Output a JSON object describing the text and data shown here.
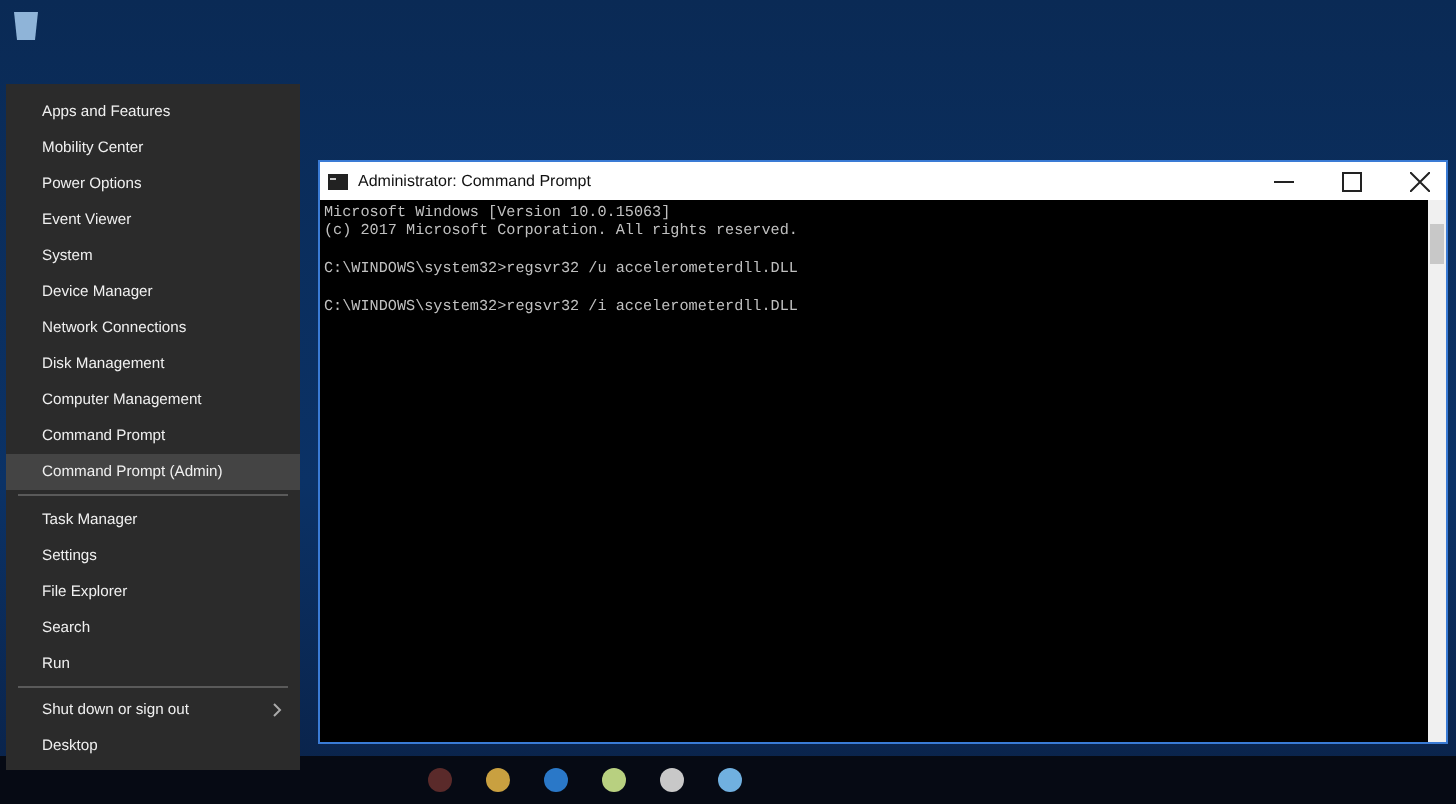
{
  "menu": {
    "groups": [
      [
        {
          "label": "Apps and Features",
          "selected": false,
          "has_submenu": false
        },
        {
          "label": "Mobility Center",
          "selected": false,
          "has_submenu": false
        },
        {
          "label": "Power Options",
          "selected": false,
          "has_submenu": false
        },
        {
          "label": "Event Viewer",
          "selected": false,
          "has_submenu": false
        },
        {
          "label": "System",
          "selected": false,
          "has_submenu": false
        },
        {
          "label": "Device Manager",
          "selected": false,
          "has_submenu": false
        },
        {
          "label": "Network Connections",
          "selected": false,
          "has_submenu": false
        },
        {
          "label": "Disk Management",
          "selected": false,
          "has_submenu": false
        },
        {
          "label": "Computer Management",
          "selected": false,
          "has_submenu": false
        },
        {
          "label": "Command Prompt",
          "selected": false,
          "has_submenu": false
        },
        {
          "label": "Command Prompt (Admin)",
          "selected": true,
          "has_submenu": false
        }
      ],
      [
        {
          "label": "Task Manager",
          "selected": false,
          "has_submenu": false
        },
        {
          "label": "Settings",
          "selected": false,
          "has_submenu": false
        },
        {
          "label": "File Explorer",
          "selected": false,
          "has_submenu": false
        },
        {
          "label": "Search",
          "selected": false,
          "has_submenu": false
        },
        {
          "label": "Run",
          "selected": false,
          "has_submenu": false
        }
      ],
      [
        {
          "label": "Shut down or sign out",
          "selected": false,
          "has_submenu": true
        },
        {
          "label": "Desktop",
          "selected": false,
          "has_submenu": false
        }
      ]
    ]
  },
  "window": {
    "title": "Administrator: Command Prompt",
    "console_paragraphs": [
      [
        "Microsoft Windows [Version 10.0.15063]",
        "(c) 2017 Microsoft Corporation. All rights reserved."
      ],
      [
        "C:\\WINDOWS\\system32>regsvr32 /u accelerometerdll.DLL"
      ],
      [
        "C:\\WINDOWS\\system32>regsvr32 /i accelerometerdll.DLL"
      ]
    ]
  }
}
